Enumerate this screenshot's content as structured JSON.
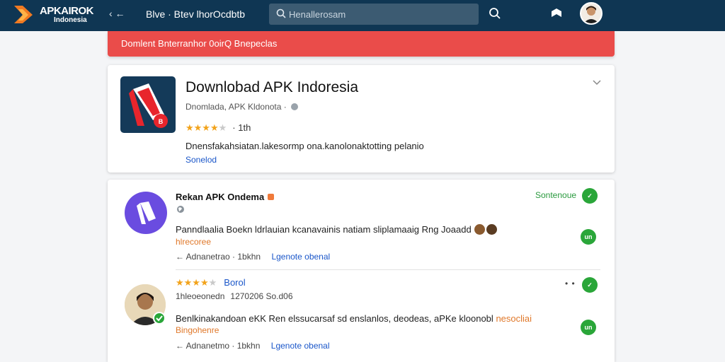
{
  "header": {
    "brand": "APKAIROK",
    "brand_sub": "Indonesia",
    "back_label": "‹ ←",
    "nav_link": "Blve · Btev lhorOcdbtb",
    "search_placeholder": "Henallerosam",
    "colors": {
      "bar": "#0f3653",
      "logo_orange": "#f07a22"
    }
  },
  "banner": {
    "text": "Domlent Bnterranhor  0oirQ Bnepeclas",
    "color": "#ea4c4a"
  },
  "app": {
    "title": "Downlobad APK Indoresia",
    "developer": "Dnomlada,  APK Kldonota ·",
    "rating": 3.5,
    "rating_count": "· 1th",
    "description": "Dnensfakahsiatan.lakesormp ona.kanolonaktotting pelanio",
    "link": "Sonelod",
    "icon_badge": "B",
    "icon": "chevron-down-icon"
  },
  "reviews": [
    {
      "name": "Rekan APK Ondema",
      "status": "Sontenoue",
      "badge_top": "✓",
      "badge_side": "un",
      "text": "Panndlaalia Boekn ldrlauian kcanavainis natiam sliplamaaig Rng Joaadd",
      "sub": "hlrecoree",
      "action_reply": "Adnanetrao · 1bkhn",
      "action_link": "Lgenote obenal"
    },
    {
      "rating": 4.5,
      "rating_label": "Borol",
      "meta_user": "1hleoeonedn",
      "meta_when": "1270206 So.d06",
      "dots": "• •",
      "badge_top": "✓",
      "badge_side": "un",
      "text": "Benlkinakandoan eKK Ren elssucarsaf sd enslanlos, deodeas, aPKe kloonobl",
      "text_highlight": "nesocliai",
      "sub": "Bingohenre",
      "action_reply": "Adnanetmo · 1bkhn",
      "action_link": "Lgenote obenal"
    }
  ]
}
